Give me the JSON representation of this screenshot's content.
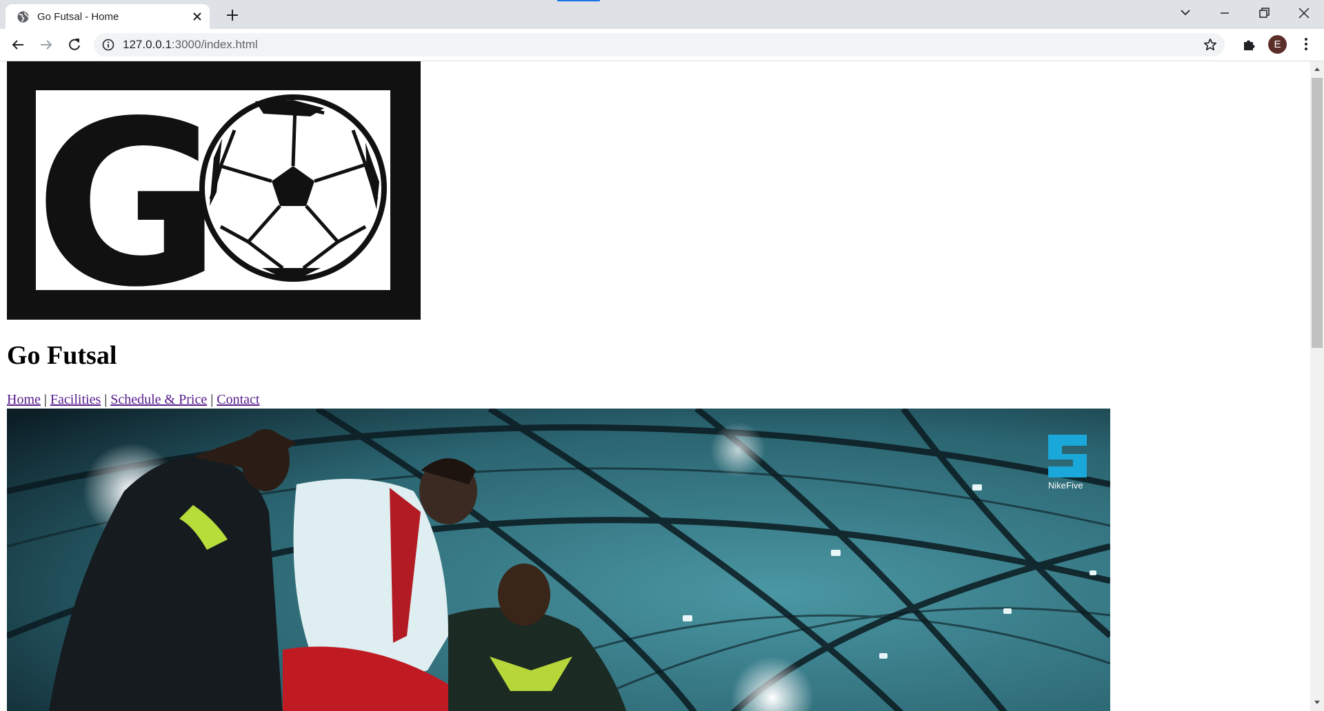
{
  "browser": {
    "tab_title": "Go Futsal - Home",
    "url_host": "127.0.0.1",
    "url_path": ":3000/index.html",
    "profile_initial": "E"
  },
  "page": {
    "heading": "Go Futsal",
    "nav": {
      "home": "Home",
      "facilities": "Facilities",
      "schedule": "Schedule & Price",
      "contact": "Contact",
      "separator": "|"
    },
    "logo": {
      "letter": "G"
    },
    "hero": {
      "brand_caption": "NikeFive"
    }
  },
  "colors": {
    "logo_frame": "#111111",
    "link": "#551a8b",
    "hero_teal": "#2e6f7a",
    "brand_cyan": "#1aa7d9"
  }
}
